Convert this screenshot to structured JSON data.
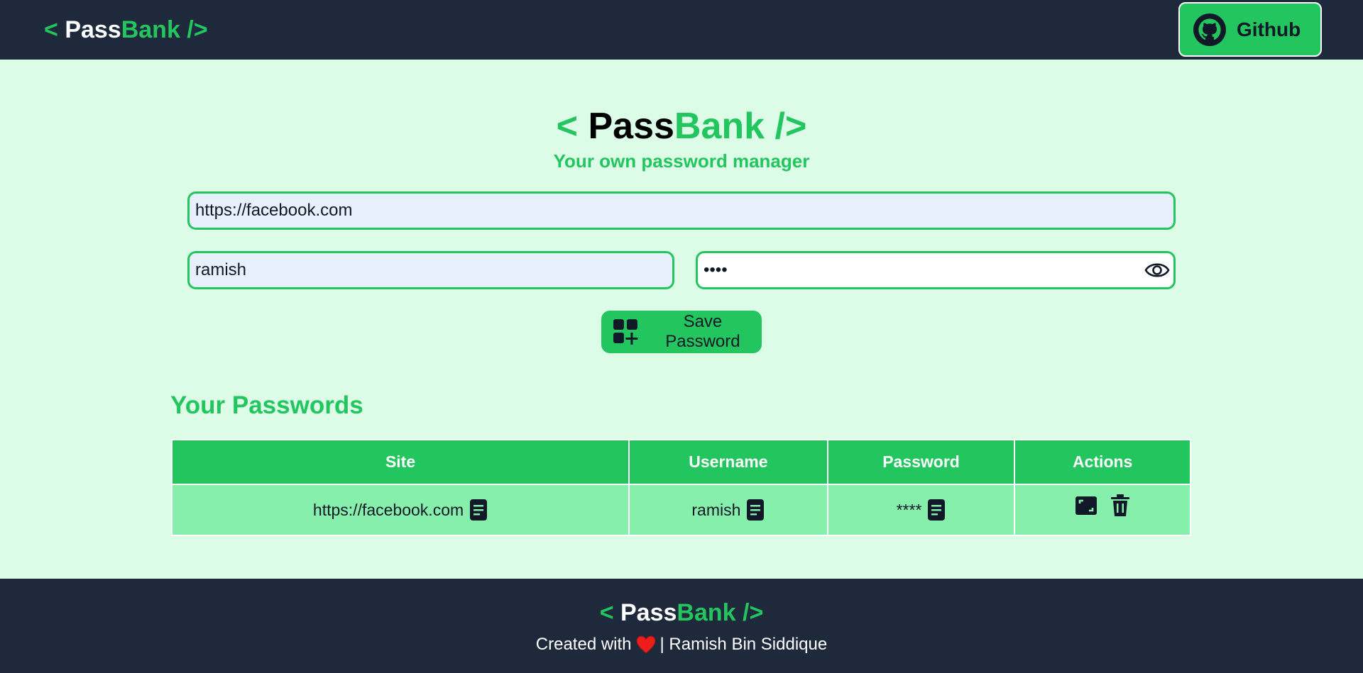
{
  "brand": {
    "open": "< ",
    "pass": "Pass",
    "bank": "Bank",
    "close": " />"
  },
  "navbar": {
    "github_label": "Github"
  },
  "hero": {
    "subtitle": "Your own password manager"
  },
  "form": {
    "site_value": "https://facebook.com",
    "username_value": "ramish",
    "password_value": "****",
    "save_label": "Save Password"
  },
  "passwords": {
    "title": "Your Passwords",
    "columns": [
      "Site",
      "Username",
      "Password",
      "Actions"
    ],
    "rows": [
      {
        "site": "https://facebook.com",
        "username": "ramish",
        "password": "****"
      }
    ]
  },
  "footer": {
    "created_with": "Created with",
    "author": "| Ramish Bin Siddique"
  },
  "colors": {
    "accent": "#22c55e",
    "navbar": "#1e293b",
    "background": "#dcfce7",
    "row": "#86efac"
  },
  "icons": [
    "github-icon",
    "eye-icon",
    "add-grid-icon",
    "copy-icon",
    "edit-icon",
    "trash-icon",
    "heart-icon"
  ]
}
